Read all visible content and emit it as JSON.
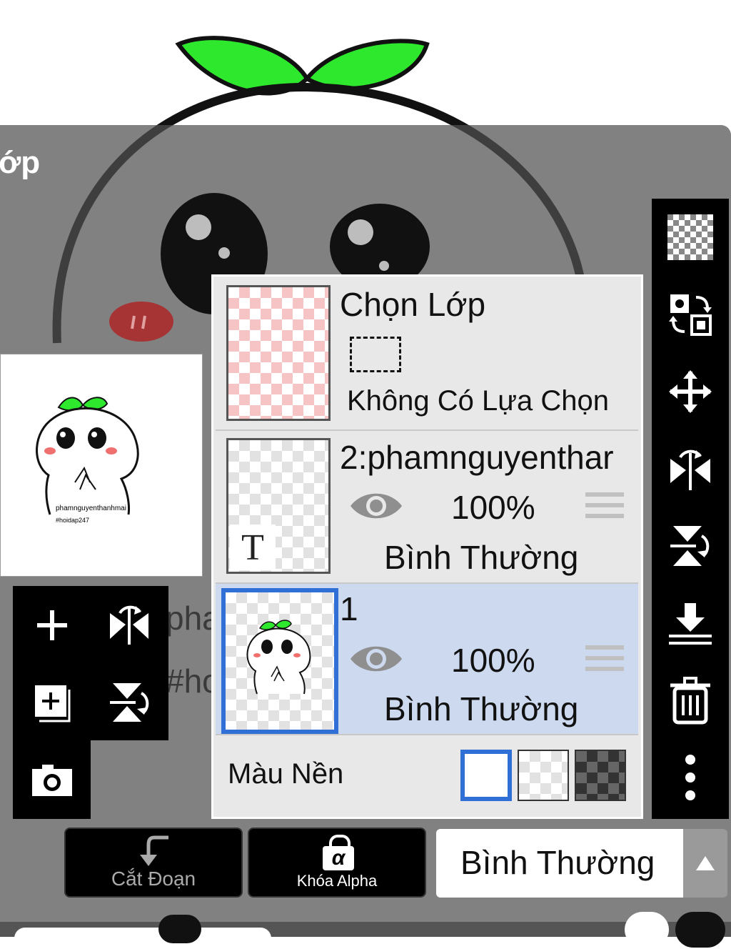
{
  "panel": {
    "title": "ớp"
  },
  "preview": {
    "line1": "phamnguyenthanhmai",
    "line2": "#hoidap247"
  },
  "ghost_text": {
    "line1": "pha",
    "line2": "#ho"
  },
  "layers": {
    "selection_layer": {
      "title": "Chọn Lớp",
      "status": "Không Có Lựa Chọn"
    },
    "items": [
      {
        "name": "2:phamnguyenthar",
        "opacity": "100%",
        "blend": "Bình Thường",
        "thumb_glyph": "T"
      },
      {
        "name": "1",
        "opacity": "100%",
        "blend": "Bình Thường"
      }
    ],
    "background": {
      "label": "Màu Nền"
    }
  },
  "bottom": {
    "clip_label": "Cắt Đoạn",
    "alpha_label": "Khóa Alpha",
    "alpha_glyph": "α",
    "blend_mode": "Bình Thường"
  },
  "icons": {
    "left": [
      "add-layer-icon",
      "flip-horizontal-icon",
      "add-copy-icon",
      "flip-vertical-icon",
      "camera-icon"
    ],
    "right": [
      "transparency-icon",
      "swap-icon",
      "move-icon",
      "flip-horizontal-icon",
      "flip-vertical-icon",
      "merge-down-icon",
      "trash-icon",
      "more-icon"
    ]
  },
  "colors": {
    "accent": "#2f6fd6",
    "selected_row": "#cdd9ee",
    "leaf_green": "#2ee82e"
  }
}
